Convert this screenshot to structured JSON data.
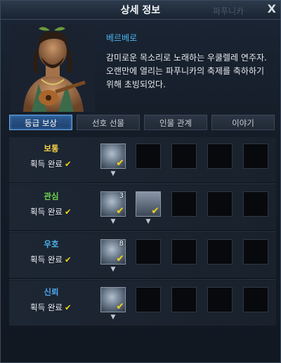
{
  "window": {
    "title": "상세 정보",
    "ghost_title": "파푸니카",
    "close": "X"
  },
  "npc": {
    "name": "베르베로",
    "description": "감미로운 목소리로 노래하는 우쿨렐레 연주자. 오랜만에 열리는 파푸니카의 축제를 축하하기 위해 초빙되었다."
  },
  "tabs": [
    "등급 보상",
    "선호 선물",
    "인물 관계",
    "이야기"
  ],
  "active_tab": "등급 보상",
  "rows": [
    {
      "label": "보통",
      "label_color": "#f3d04a",
      "status": "획득 완료",
      "items": [
        {
          "icon": "coin-icon",
          "count": ""
        }
      ]
    },
    {
      "label": "관심",
      "label_color": "#6fd34a",
      "status": "획득 완료",
      "items": [
        {
          "icon": "feather-scroll-icon",
          "count": "3"
        },
        {
          "icon": "card-icon",
          "count": ""
        }
      ]
    },
    {
      "label": "우호",
      "label_color": "#4cb6ee",
      "status": "획득 완료",
      "items": [
        {
          "icon": "coin-icon",
          "count": "8"
        }
      ]
    },
    {
      "label": "신뢰",
      "label_color": "#4fa8f0",
      "status": "획득 완료",
      "items": [
        {
          "icon": "horn-icon",
          "count": ""
        }
      ]
    }
  ],
  "colors": {
    "accent": "#49b3ee",
    "check": "#f4d21a"
  }
}
